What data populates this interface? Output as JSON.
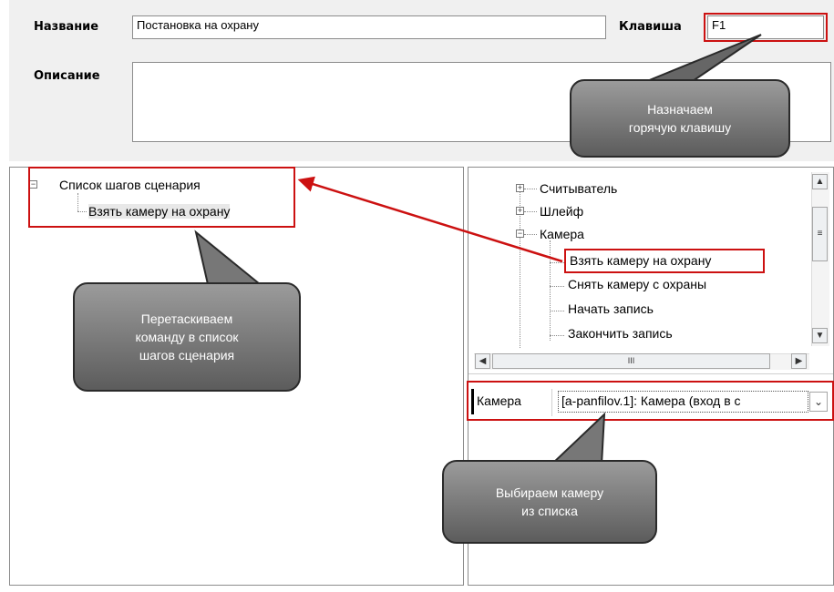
{
  "header": {
    "name_label": "Название",
    "name_value": "Постановка на охрану",
    "hotkey_label": "Клавиша",
    "hotkey_value": "F1",
    "description_label": "Описание",
    "description_value": ""
  },
  "steps_tree": {
    "root": "Список шагов сценария",
    "items": [
      "Взять камеру на охрану"
    ]
  },
  "commands_tree": {
    "groups": [
      {
        "label": "Считыватель",
        "expanded": false
      },
      {
        "label": "Шлейф",
        "expanded": false
      },
      {
        "label": "Камера",
        "expanded": true
      }
    ],
    "children": [
      "Взять камеру на охрану",
      "Снять камеру с охраны",
      "Начать запись",
      "Закончить запись"
    ],
    "selected": "Взять камеру на охрану",
    "hscroll_thumb": "III"
  },
  "property": {
    "label": "Камера",
    "value": "[a-panfilov.1]: Камера (вход в с"
  },
  "callouts": {
    "hotkey": "Назначаем\nгорячую клавишу",
    "drag": "Перетаскиваем\nкоманду в список\nшагов сценария",
    "camera": "Выбираем камеру\nиз списка"
  },
  "colors": {
    "highlight_border": "#cc1111",
    "arrow": "#cc1111",
    "callout_fill": "#7a7a7a"
  }
}
